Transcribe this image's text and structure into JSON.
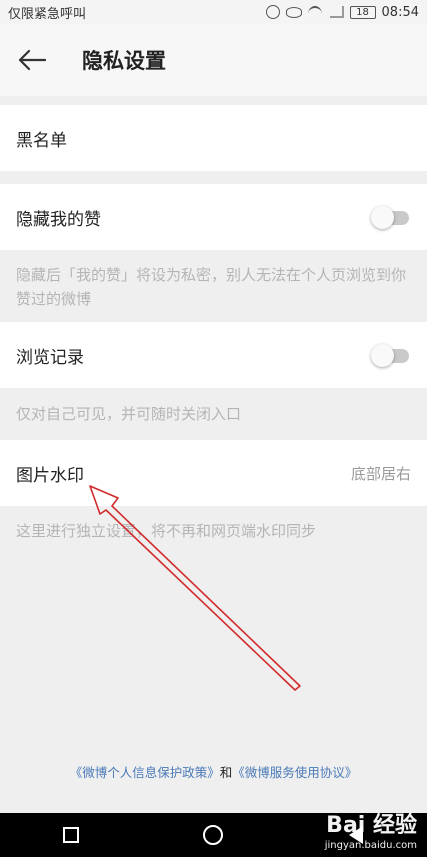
{
  "status_bar": {
    "left_text": "仅限紧急呼叫",
    "battery": "18",
    "time": "08:54"
  },
  "header": {
    "title": "隐私设置"
  },
  "settings": {
    "blacklist": {
      "label": "黑名单"
    },
    "hide_likes": {
      "label": "隐藏我的赞",
      "enabled": false,
      "hint": "隐藏后「我的赞」将设为私密，别人无法在个人页浏览到你赞过的微博"
    },
    "browse_history": {
      "label": "浏览记录",
      "enabled": false,
      "hint": "仅对自己可见，并可随时关闭入口"
    },
    "image_watermark": {
      "label": "图片水印",
      "value": "底部居右",
      "hint": "这里进行独立设置，将不再和网页端水印同步"
    }
  },
  "footer": {
    "privacy_policy": "《微博个人信息保护政策》",
    "connector": "和",
    "service_agreement": "《微博服务使用协议》"
  },
  "watermark_overlay": {
    "logo": "Bai 经验",
    "url": "jingyan.baidu.com"
  },
  "colors": {
    "background": "#efefef",
    "link": "#4a7ab8",
    "annotation_arrow": "#d22b2b"
  }
}
